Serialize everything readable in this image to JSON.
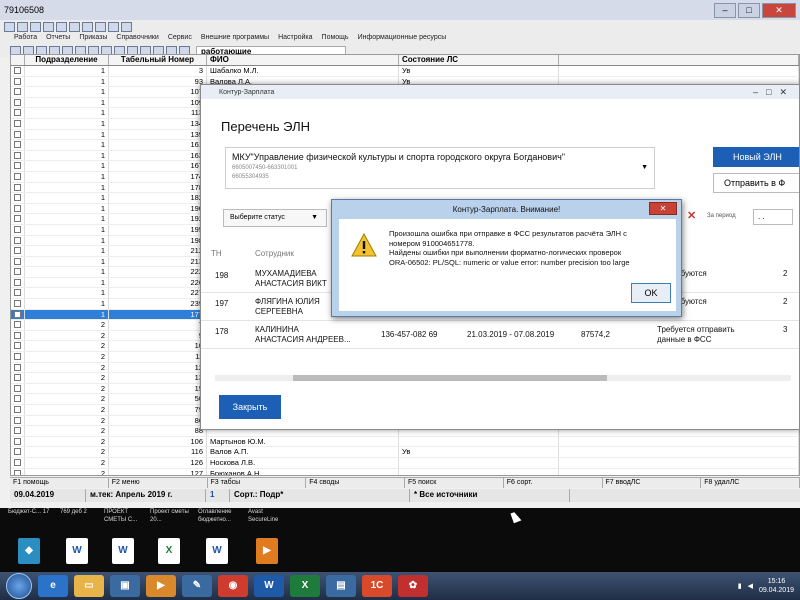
{
  "app": {
    "title": "79106508",
    "menu": [
      "Работа",
      "Отчеты",
      "Приказы",
      "Справочники",
      "Сервис",
      "Внешние программы",
      "Настройка",
      "Помощь",
      "Информационные ресурсы"
    ],
    "filter_label": "работающие"
  },
  "grid": {
    "headers": [
      "",
      "Подразделение",
      "Табельный Номер",
      "ФИО",
      "Состояние ЛС",
      ""
    ],
    "rows": [
      {
        "dept": "1",
        "tab": "3",
        "fio": "Шабалко М.Л.",
        "state": "Ув"
      },
      {
        "dept": "1",
        "tab": "93",
        "fio": "Валова Л.А.",
        "state": "Ув"
      },
      {
        "dept": "1",
        "tab": "107",
        "fio": "",
        "state": ""
      },
      {
        "dept": "1",
        "tab": "109",
        "fio": "",
        "state": ""
      },
      {
        "dept": "1",
        "tab": "113",
        "fio": "",
        "state": ""
      },
      {
        "dept": "1",
        "tab": "134",
        "fio": "",
        "state": ""
      },
      {
        "dept": "1",
        "tab": "139",
        "fio": "",
        "state": ""
      },
      {
        "dept": "1",
        "tab": "161",
        "fio": "",
        "state": ""
      },
      {
        "dept": "1",
        "tab": "163",
        "fio": "",
        "state": ""
      },
      {
        "dept": "1",
        "tab": "167",
        "fio": "",
        "state": ""
      },
      {
        "dept": "1",
        "tab": "174",
        "fio": "",
        "state": ""
      },
      {
        "dept": "1",
        "tab": "178",
        "fio": "",
        "state": ""
      },
      {
        "dept": "1",
        "tab": "182",
        "fio": "",
        "state": ""
      },
      {
        "dept": "1",
        "tab": "190",
        "fio": "",
        "state": ""
      },
      {
        "dept": "1",
        "tab": "192",
        "fio": "",
        "state": ""
      },
      {
        "dept": "1",
        "tab": "195",
        "fio": "",
        "state": ""
      },
      {
        "dept": "1",
        "tab": "198",
        "fio": "",
        "state": ""
      },
      {
        "dept": "1",
        "tab": "212",
        "fio": "",
        "state": ""
      },
      {
        "dept": "1",
        "tab": "213",
        "fio": "",
        "state": ""
      },
      {
        "dept": "1",
        "tab": "222",
        "fio": "",
        "state": ""
      },
      {
        "dept": "1",
        "tab": "226",
        "fio": "",
        "state": ""
      },
      {
        "dept": "1",
        "tab": "227",
        "fio": "",
        "state": ""
      },
      {
        "dept": "1",
        "tab": "239",
        "fio": "",
        "state": ""
      },
      {
        "dept": "1",
        "tab": "177",
        "fio": "",
        "state": "",
        "selected": true
      },
      {
        "dept": "2",
        "tab": "7",
        "fio": "",
        "state": ""
      },
      {
        "dept": "2",
        "tab": "9",
        "fio": "",
        "state": ""
      },
      {
        "dept": "2",
        "tab": "10",
        "fio": "",
        "state": ""
      },
      {
        "dept": "2",
        "tab": "11",
        "fio": "",
        "state": ""
      },
      {
        "dept": "2",
        "tab": "12",
        "fio": "",
        "state": ""
      },
      {
        "dept": "2",
        "tab": "13",
        "fio": "",
        "state": ""
      },
      {
        "dept": "2",
        "tab": "15",
        "fio": "",
        "state": ""
      },
      {
        "dept": "2",
        "tab": "50",
        "fio": "",
        "state": ""
      },
      {
        "dept": "2",
        "tab": "79",
        "fio": "",
        "state": ""
      },
      {
        "dept": "2",
        "tab": "86",
        "fio": "",
        "state": ""
      },
      {
        "dept": "2",
        "tab": "88",
        "fio": "",
        "state": ""
      },
      {
        "dept": "2",
        "tab": "106",
        "fio": "Мартынов Ю.М.",
        "state": ""
      },
      {
        "dept": "2",
        "tab": "116",
        "fio": "Валов А.П.",
        "state": "Ув"
      },
      {
        "dept": "2",
        "tab": "126",
        "fio": "Носкова Л.В.",
        "state": ""
      },
      {
        "dept": "2",
        "tab": "127",
        "fio": "Брюханов А.Н.",
        "state": ""
      }
    ]
  },
  "fkeys": [
    "F1 помощь",
    "F2 меню",
    "F3 табсы",
    "F4 своды",
    "F5 поиск",
    "F6 сорт.",
    "F7 вводЛС",
    "F8 удалЛС"
  ],
  "status": {
    "date": "09.04.2019",
    "period": "м.тек: Апрель 2019 г.",
    "num": "1",
    "sort": "Сорт.: Подр*",
    "sources": "* Все источники"
  },
  "kontur": {
    "title": "Контур-Зарплата",
    "heading": "Перечень ЭЛН",
    "org_name": "МКУ\"Управление физической культуры и спорта городского округа Богданович\"",
    "org_line1": "6605007450-663301001",
    "org_line2": "66055304935",
    "btn_new": "Новый ЭЛН",
    "btn_send": "Отправить в Ф",
    "status_select": "Выберите статус",
    "period_label": "За период",
    "period_value": ". .",
    "col_tn": "ТН",
    "col_employee": "Сотрудник",
    "rows": [
      {
        "tn": "198",
        "name1": "МУХАМАДИЕВА",
        "name2": "АНАСТАСИЯ  ВИКТ",
        "snils": "",
        "dates": "",
        "num": "",
        "status1": "не требуются",
        "status2": "",
        "extra": "2"
      },
      {
        "tn": "197",
        "name1": "ФЛЯГИНА  ЮЛИЯ",
        "name2": "СЕРГЕЕВНА",
        "snils": "",
        "dates": "",
        "num": "",
        "status1": "не требуются",
        "status2": "",
        "extra": "2"
      },
      {
        "tn": "178",
        "name1": "КАЛИНИНА",
        "name2": "АНАСТАСИЯ  АНДРЕЕВ...",
        "snils": "136-457-082 69",
        "dates": "21.03.2019 - 07.08.2019",
        "num": "87574,2",
        "status1": "Требуется отправить",
        "status2": "данные в ФСС",
        "extra": "3"
      }
    ],
    "btn_close": "Закрыть"
  },
  "alert": {
    "title": "Контур-Зарплата. Внимание!",
    "line1": "Произошла ошибка при отправке в ФСС результатов расчёта ЭЛН с",
    "line2": "номером 910004651778.",
    "line3": "Найдены ошибки при выполнении форматно-логических проверок",
    "line4": "ORA-06502: PL/SQL: numeric or value error: number precision too large",
    "ok": "OK"
  },
  "desktop": {
    "labels": [
      "Бюджет-С... 17",
      "769 деб 2",
      "ПРОЕКТ СМЕТЫ С...",
      "Проект сметы 20...",
      "Оглавление бюджетно...",
      "Avast SecureLine"
    ]
  },
  "taskbar": {
    "time": "15:16",
    "date": "09.04.2019"
  },
  "colors": {
    "selection": "#2f7fd8",
    "kontur_blue": "#1c5fb5",
    "alert_frame": "#b9d1ea"
  }
}
